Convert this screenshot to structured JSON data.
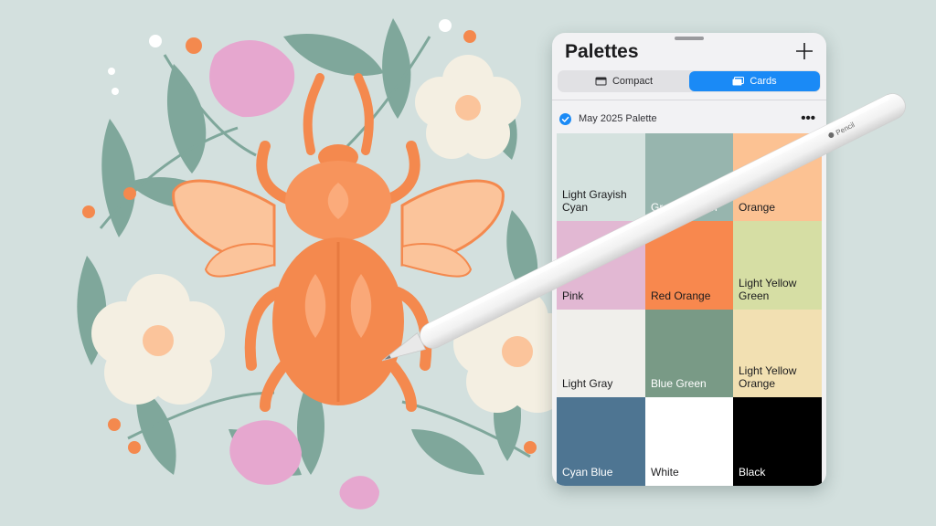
{
  "panel": {
    "title": "Palettes",
    "add_icon": "plus-icon",
    "view_modes": [
      {
        "label": "Compact",
        "icon": "compact-view-icon",
        "selected": false
      },
      {
        "label": "Cards",
        "icon": "cards-view-icon",
        "selected": true
      }
    ],
    "palette": {
      "name": "May 2025 Palette",
      "checked": true,
      "more_icon": "ellipsis-icon",
      "more_label": "•••"
    },
    "swatches": [
      {
        "name": "Light Grayish\nCyan",
        "color": "#d5e2df",
        "text_color": "#1c1c1e"
      },
      {
        "name": "Grayish Cyan",
        "color": "#97b5ae",
        "text_color": "#ffffff"
      },
      {
        "name": "Orange",
        "color": "#fcc293",
        "text_color": "#1c1c1e"
      },
      {
        "name": "Pink",
        "color": "#e2b8d3",
        "text_color": "#1c1c1e"
      },
      {
        "name": "Red Orange",
        "color": "#f8884e",
        "text_color": "#1c1c1e"
      },
      {
        "name": "Light Yellow\nGreen",
        "color": "#d6dea4",
        "text_color": "#1c1c1e"
      },
      {
        "name": "Light Gray",
        "color": "#f0efeb",
        "text_color": "#1c1c1e"
      },
      {
        "name": "Blue Green",
        "color": "#799a86",
        "text_color": "#ffffff"
      },
      {
        "name": "Light Yellow\nOrange",
        "color": "#f2e0b2",
        "text_color": "#1c1c1e"
      },
      {
        "name": "Cyan Blue",
        "color": "#4e7592",
        "text_color": "#ffffff"
      },
      {
        "name": "White",
        "color": "#ffffff",
        "text_color": "#1c1c1e"
      },
      {
        "name": "Black",
        "color": "#000000",
        "text_color": "#ffffff"
      }
    ]
  },
  "pencil": {
    "brand": "Pencil",
    "logo_icon": "apple-logo-icon"
  },
  "colors": {
    "background": "#d3e0de",
    "accent": "#1a8af6",
    "beetle": "#f4894e",
    "wing": "#fbc49b",
    "leaf": "#7fa79b",
    "blossom": "#f4efe2",
    "petal_pink": "#e6a7cf"
  }
}
